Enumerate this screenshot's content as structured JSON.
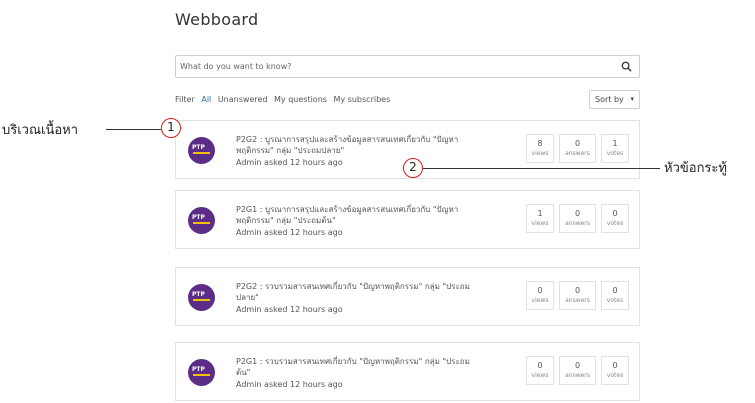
{
  "page": {
    "title": "Webboard"
  },
  "search": {
    "placeholder": "What do you want to know?",
    "icon": "search-icon"
  },
  "filter": {
    "label": "Filter",
    "options": [
      "All",
      "Unanswered",
      "My questions",
      "My subscribes"
    ],
    "active": "All"
  },
  "sort": {
    "label": "Sort by",
    "caret": "▾"
  },
  "annotations": {
    "content_area": {
      "number": "1",
      "label": "บริเวณเนื้อหา"
    },
    "topic": {
      "number": "2",
      "label": "หัวข้อกระทู้"
    }
  },
  "stat_labels": {
    "views": "views",
    "answers": "answers",
    "votes": "votes"
  },
  "avatar_text": "PTP",
  "questions": [
    {
      "title": "P2G2 : บูรณาการสรุปและสร้างข้อมูลสารสนเทศเกี่ยวกับ \"ปัญหาพฤติกรรม\" กลุ่ม \"ประถมปลาย\"",
      "meta": "Admin asked 12 hours ago",
      "views": "8",
      "answers": "0",
      "votes": "1"
    },
    {
      "title": "P2G1 : บูรณาการสรุปและสร้างข้อมูลสารสนเทศเกี่ยวกับ \"ปัญหาพฤติกรรม\" กลุ่ม \"ประถมต้น\"",
      "meta": "Admin asked 12 hours ago",
      "views": "1",
      "answers": "0",
      "votes": "0"
    },
    {
      "title": "P2G2 : รวบรวมสารสนเทศเกี่ยวกับ \"ปัญหาพฤติกรรม\" กลุ่ม \"ประถมปลาย\"",
      "meta": "Admin asked 12 hours ago",
      "views": "0",
      "answers": "0",
      "votes": "0"
    },
    {
      "title": "P2G1 : รวบรวมสารสนเทศเกี่ยวกับ \"ปัญหาพฤติกรรม\" กลุ่ม \"ประถมต้น\"",
      "meta": "Admin asked 12 hours ago",
      "views": "0",
      "answers": "0",
      "votes": "0"
    }
  ]
}
